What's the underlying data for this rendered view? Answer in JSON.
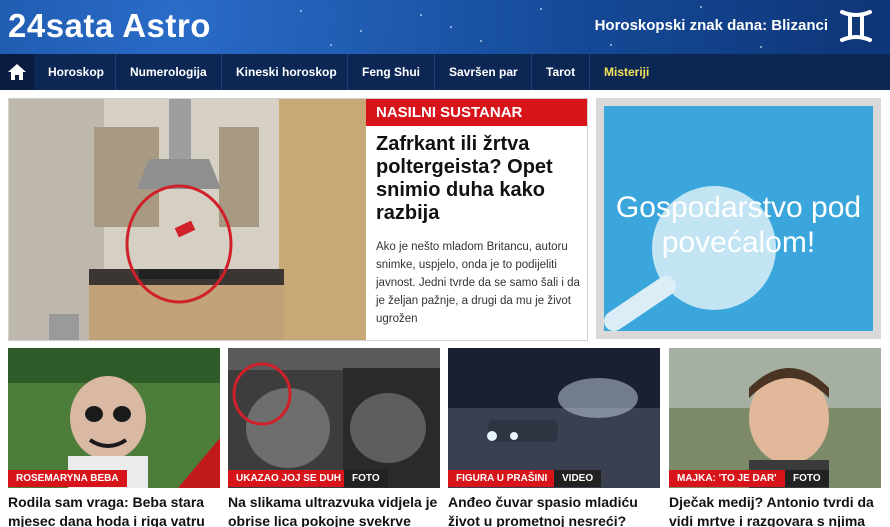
{
  "header": {
    "logo": "24sata Astro",
    "sign_of_day": "Horoskopski znak dana: Blizanci",
    "sign_icon": "gemini-icon"
  },
  "nav": {
    "home_icon": "home-icon",
    "items": [
      {
        "label": "Horoskop"
      },
      {
        "label": "Numerologija"
      },
      {
        "label": "Kineski horoskop"
      },
      {
        "label": "Feng Shui"
      },
      {
        "label": "Savršen par"
      },
      {
        "label": "Tarot"
      },
      {
        "label": "Misteriji"
      }
    ]
  },
  "hero": {
    "kicker": "NASILNI SUSTANAR",
    "title": "Zafrkant ili žrtva poltergeista? Opet snimio duha kako razbija",
    "body": "Ako je nešto mladom Britancu, autoru snimke, uspjelo, onda je to podijeliti javnost. Jedni tvrde da se samo šali i da je željan pažnje, a drugi da mu je život ugrožen"
  },
  "ad": {
    "text": "Gospodarstvo pod povećalom!"
  },
  "cards": [
    {
      "tag": "ROSEMARYNA BEBA",
      "badge": "",
      "title": "Rodila sam vraga: Beba stara mjesec dana hoda i riga vatru"
    },
    {
      "tag": "UKAZAO JOJ SE DUH",
      "badge": "FOTO",
      "title": "Na slikama ultrazvuka vidjela je obrise lica pokojne svekrve"
    },
    {
      "tag": "FIGURA U PRAŠINI",
      "badge": "VIDEO",
      "title": "Anđeo čuvar spasio mladiću život u prometnoj nesreći?"
    },
    {
      "tag": "MAJKA: 'TO JE DAR'",
      "badge": "FOTO",
      "title": "Dječak medij? Antonio tvrdi da vidi mrtve i razgovara s njima"
    }
  ],
  "colors": {
    "header_blue": "#154a98",
    "nav_bg": "#0d2755",
    "accent_red": "#d8141b",
    "active_nav": "#f6e15a",
    "ad_blue": "#3aa6db"
  }
}
